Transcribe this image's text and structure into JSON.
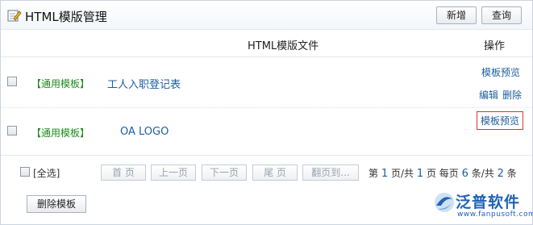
{
  "header": {
    "title": "HTML模版管理",
    "new_label": "新增",
    "query_label": "查询"
  },
  "columns": {
    "file": "HTML模版文件",
    "operation": "操作"
  },
  "rows": [
    {
      "tag": "【通用模板】",
      "name": "工人入职登记表",
      "ops": [
        "模板预览",
        "编辑",
        "删除"
      ]
    },
    {
      "tag": "【通用模板】",
      "name": "OA LOGO",
      "ops": [
        "模板预览"
      ]
    }
  ],
  "pager": {
    "select_all": "[全选]",
    "buttons": [
      "首 页",
      "上一页",
      "下一页",
      "尾 页",
      "翻页到..."
    ],
    "info_prefix": "第",
    "current_page": "1",
    "info_page_sep": "页/共",
    "total_pages": "1",
    "info_per_page": "页 每页",
    "per_page": "6",
    "info_total_sep": "条/共",
    "total_items": "2",
    "info_suffix": "条"
  },
  "delete_button": "删除模板",
  "logo": {
    "text": "泛普软件",
    "url": "www.fanpusoft.com"
  },
  "colors": {
    "link": "#1c5e9e",
    "tag": "#1e8a1e",
    "highlight_border": "#dd3333",
    "brand": "#1f63b5"
  }
}
